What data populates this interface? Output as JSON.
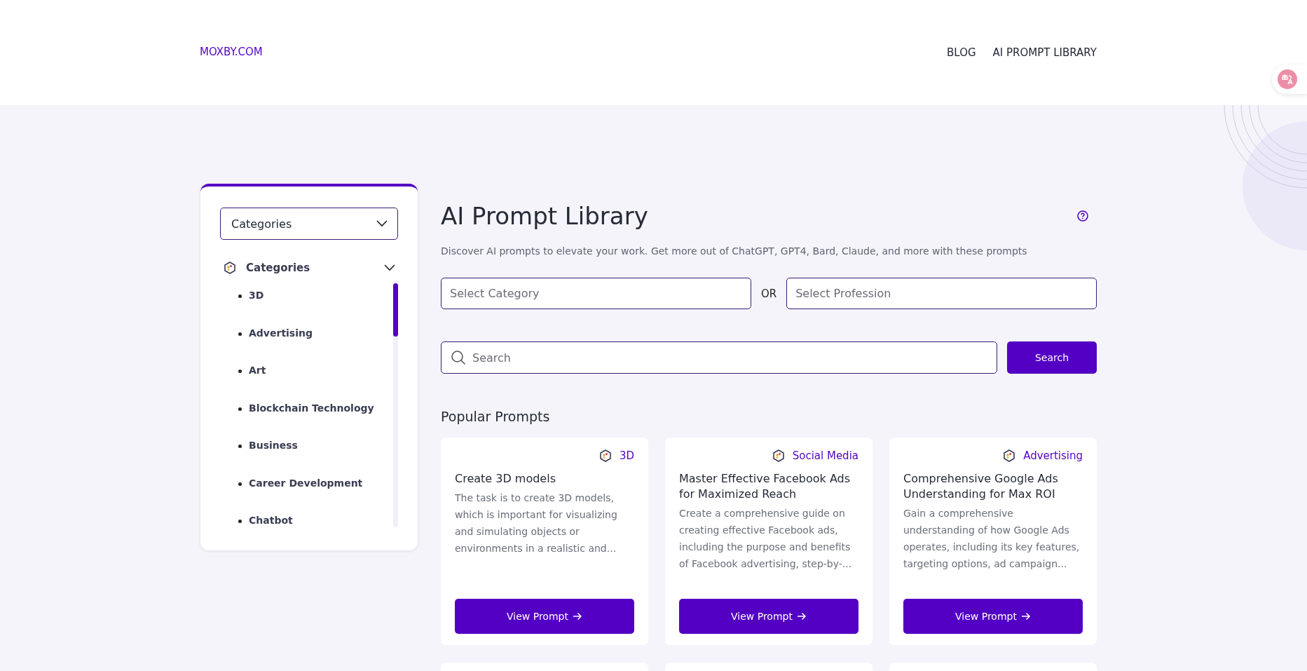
{
  "header": {
    "logo": "MOXBY.COM",
    "nav": [
      {
        "label": "BLOG"
      },
      {
        "label": "AI PROMPT LIBRARY"
      }
    ]
  },
  "sidebar": {
    "select": "Categories",
    "section": {
      "label": "Categories",
      "expanded": true,
      "items": [
        "3D",
        "Advertising",
        "Art",
        "Blockchain Technology",
        "Business",
        "Career Development",
        "Chatbot"
      ]
    }
  },
  "main": {
    "title": "AI Prompt Library",
    "subtitle": "Discover AI prompts to elevate your work. Get more out of ChatGPT, GPT4, Bard, Claude, and more with these prompts",
    "category_select": {
      "placeholder": "Select Category"
    },
    "or_label": "OR",
    "profession_select": {
      "placeholder": "Select Profession"
    },
    "search": {
      "placeholder": "Search"
    },
    "search_button": "Search",
    "popular_title": "Popular Prompts",
    "cards": [
      {
        "category": "3D",
        "title": "Create 3D models",
        "description": "The task is to create 3D models, which is important for visualizing and simulating objects or environments in a realistic and...",
        "button": "View Prompt"
      },
      {
        "category": "Social Media",
        "title": "Master Effective Facebook Ads for Maximized Reach",
        "description": "Create a comprehensive guide on creating effective Facebook ads, including the purpose and benefits of Facebook advertising, step-by-...",
        "button": "View Prompt"
      },
      {
        "category": "Advertising",
        "title": "Comprehensive Google Ads Understanding for Max ROI",
        "description": "Gain a comprehensive understanding of how Google Ads operates, including its key features, targeting options, ad campaign...",
        "button": "View Prompt"
      }
    ]
  }
}
